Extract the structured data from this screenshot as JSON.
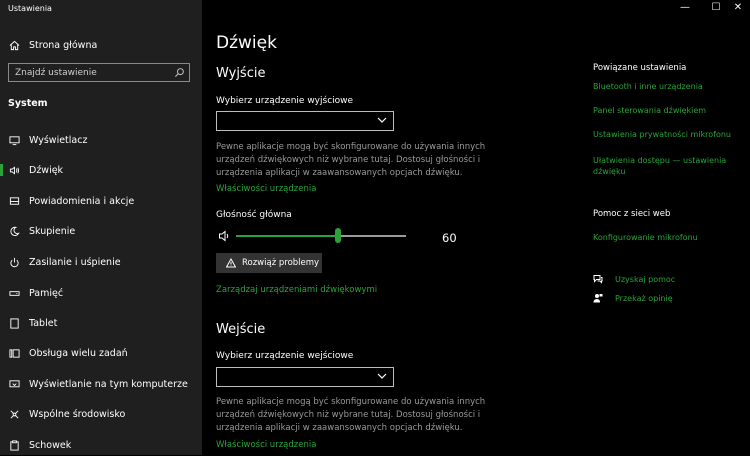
{
  "window": {
    "title": "Ustawienia",
    "minimize": "—",
    "maximize": "☐",
    "close": "✕"
  },
  "sidebar": {
    "home_label": "Strona główna",
    "search_placeholder": "Znajdź ustawienie",
    "section": "System",
    "items": [
      {
        "label": "Wyświetlacz",
        "icon": "monitor-icon"
      },
      {
        "label": "Dźwięk",
        "icon": "speaker-icon"
      },
      {
        "label": "Powiadomienia i akcje",
        "icon": "notification-icon"
      },
      {
        "label": "Skupienie",
        "icon": "moon-icon"
      },
      {
        "label": "Zasilanie i uśpienie",
        "icon": "power-icon"
      },
      {
        "label": "Pamięć",
        "icon": "storage-icon"
      },
      {
        "label": "Tablet",
        "icon": "tablet-icon"
      },
      {
        "label": "Obsługa wielu zadań",
        "icon": "multitask-icon"
      },
      {
        "label": "Wyświetlanie na tym komputerze",
        "icon": "project-icon"
      },
      {
        "label": "Wspólne środowisko",
        "icon": "shared-icon"
      },
      {
        "label": "Schowek",
        "icon": "clipboard-icon"
      }
    ]
  },
  "main": {
    "title": "Dźwięk",
    "output": {
      "heading": "Wyjście",
      "device_label": "Wybierz urządzenie wyjściowe",
      "device_value": "",
      "description": "Pewne aplikacje mogą być skonfigurowane do używania innych urządzeń dźwiękowych niż wybrane tutaj. Dostosuj głośności i urządzenia aplikacji w zaawansowanych opcjach dźwięku.",
      "properties_link": "Właściwości urządzenia",
      "volume_label": "Głośność główna",
      "volume_value": "60",
      "volume_fraction": 0.6,
      "troubleshoot_label": "Rozwiąż problemy",
      "manage_link": "Zarządzaj urządzeniami dźwiękowymi"
    },
    "input": {
      "heading": "Wejście",
      "device_label": "Wybierz urządzenie wejściowe",
      "device_value": "",
      "description": "Pewne aplikacje mogą być skonfigurowane do używania innych urządzeń dźwiękowych niż wybrane tutaj. Dostosuj głośności i urządzenia aplikacji w zaawansowanych opcjach dźwięku.",
      "properties_link": "Właściwości urządzenia"
    }
  },
  "related": {
    "title": "Powiązane ustawienia",
    "links": [
      "Bluetooth i inne urządzenia",
      "Panel sterowania dźwiękiem",
      "Ustawienia prywatności mikrofonu",
      "Ułatwienia dostępu — ustawienia dźwięku"
    ],
    "help_title": "Pomoc z sieci web",
    "help_links": [
      "Konfigurowanie mikrofonu"
    ],
    "get_help": "Uzyskaj pomoc",
    "feedback": "Przekaż opinię"
  },
  "colors": {
    "accent": "#2aa43a",
    "sidebar_bg": "#1f1f1f",
    "main_bg": "#000000"
  }
}
